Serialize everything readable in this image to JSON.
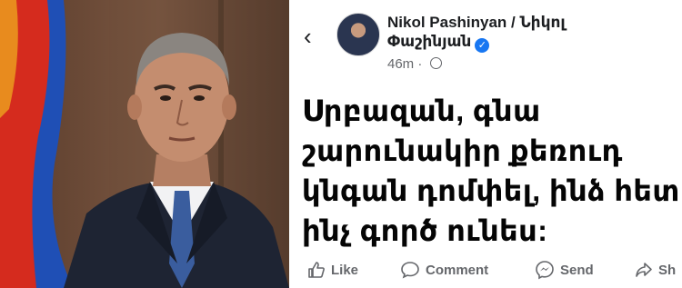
{
  "post": {
    "author": "Nikol Pashinyan / Նիկոլ\nՓաշինյան",
    "time": "46m",
    "text": "Սրբազան, գնա\nշարունակիր քեռուդ\nկնգան դոմփել, ինձ հետ\nինչ գործ ունես:"
  },
  "actions": {
    "like": "Like",
    "comment": "Comment",
    "send": "Send",
    "share": "Sh"
  },
  "icons": {
    "back": "chevron-left-icon",
    "verified": "verified-badge-icon",
    "audience": "globe-icon"
  },
  "colors": {
    "flag_red": "#d52b1e",
    "flag_blue": "#1f4fb5",
    "verified_blue": "#1877f2",
    "meta_gray": "#65676b"
  }
}
